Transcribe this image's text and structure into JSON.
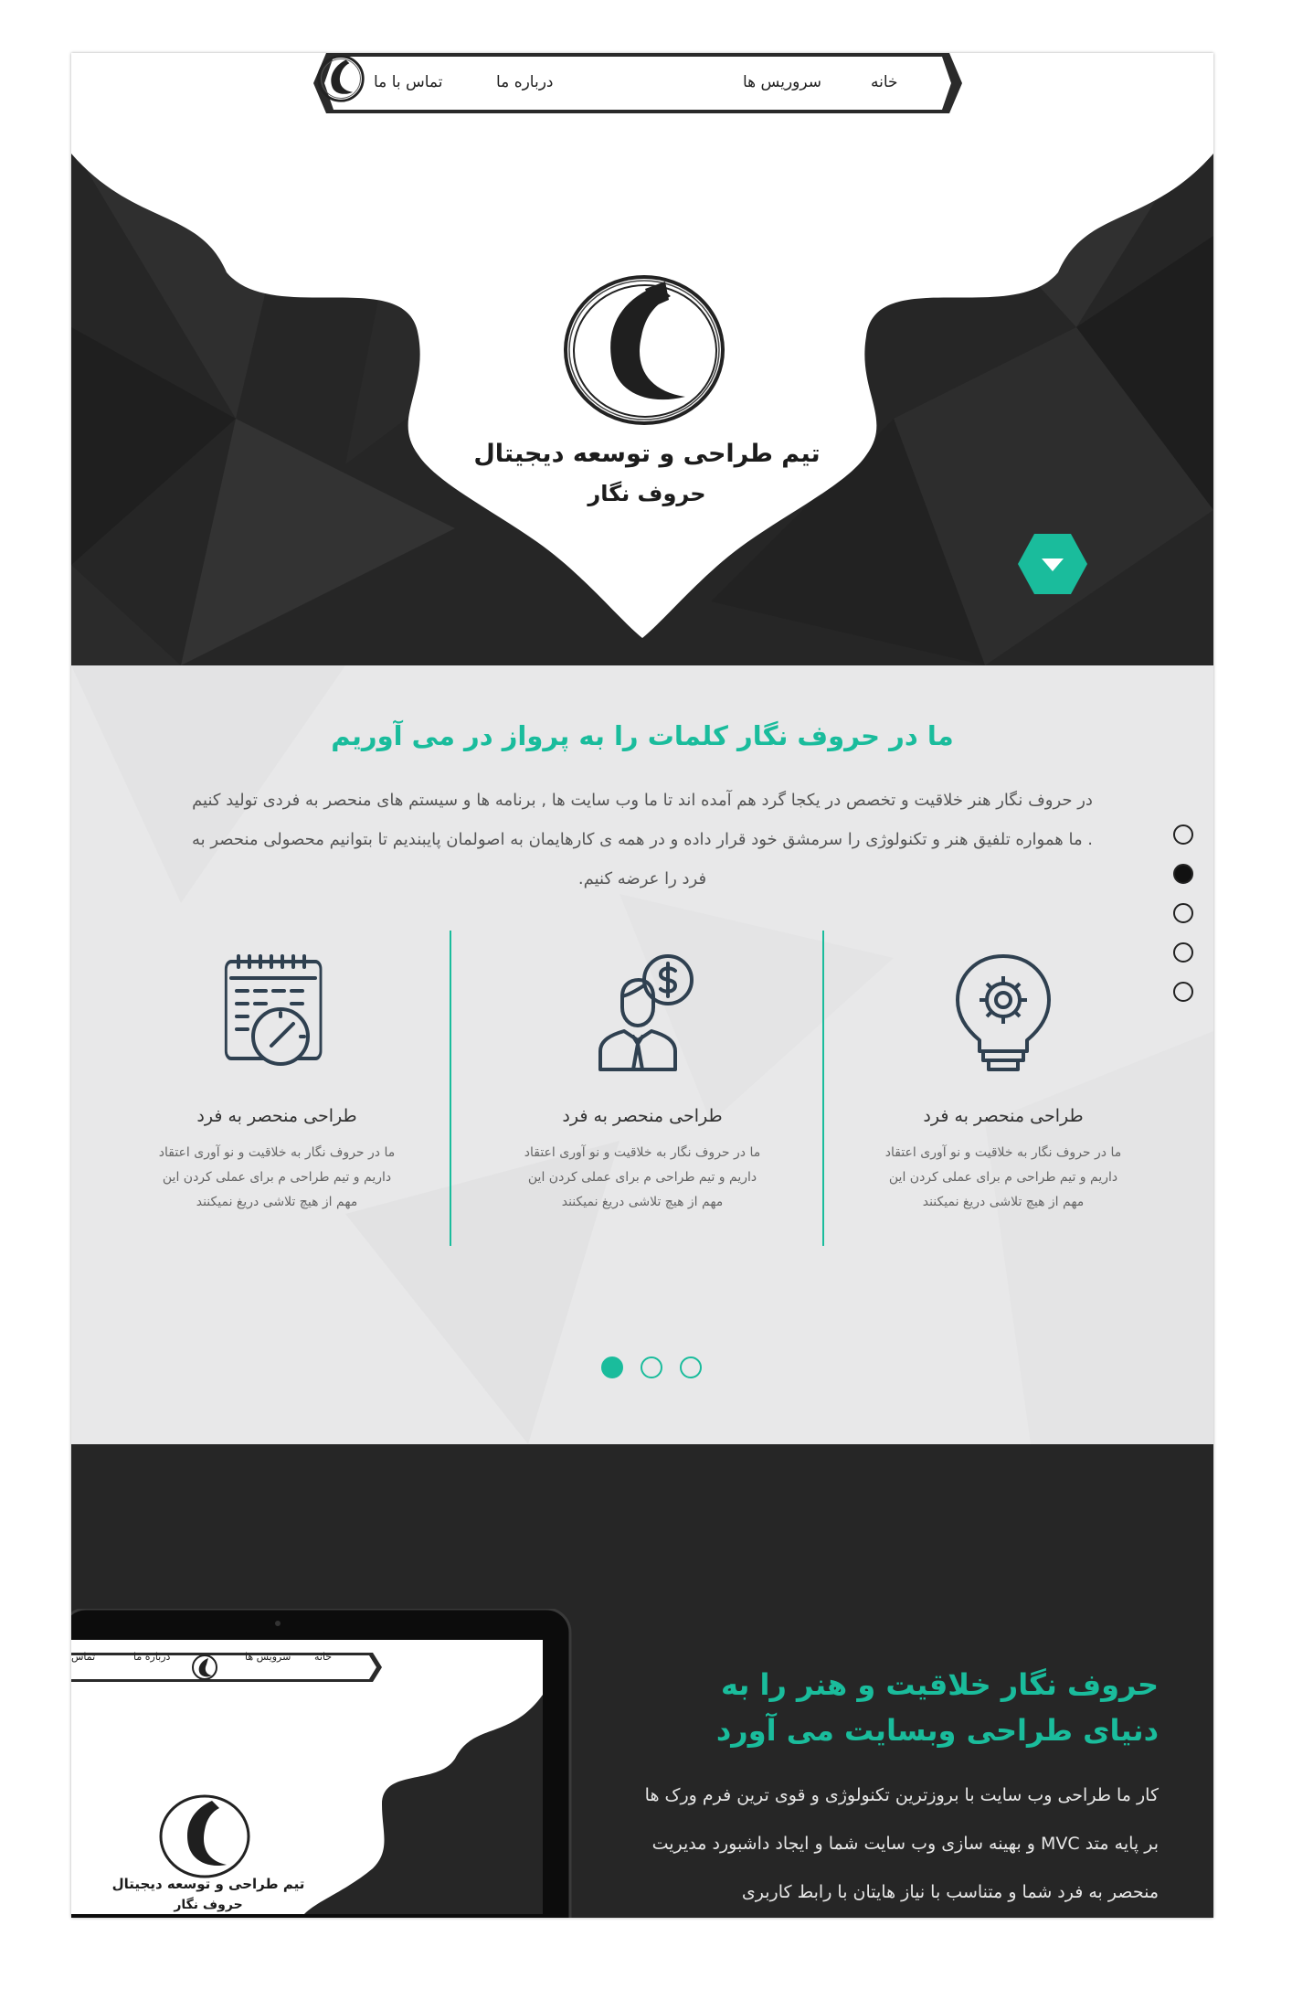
{
  "nav": {
    "home": "خانه",
    "services": "سروریس ها",
    "about": "درباره ما",
    "contact": "تماس با ما"
  },
  "hero": {
    "title": "تیم طراحی و توسعه دیجیتال",
    "subtitle": "حروف نگار"
  },
  "about": {
    "title": "ما در حروف نگار کلمات را به پرواز در می آوریم",
    "text": "در حروف نگار هنر خلاقیت و تخصص در یکجا گرد هم آمده اند تا ما وب سایت ها , برنامه ها و سیستم های منحصر به فردی تولید کنیم . ما همواره تلفیق هنر و تکنولوژی را سرمشق خود قرار داده و در همه ی کارهایمان به اصولمان پایبندیم تا بتوانیم محصولی منحصر به فرد را عرضه کنیم."
  },
  "features": [
    {
      "icon": "lightbulb-gear-icon",
      "title": "طراحی منحصر به فرد",
      "desc": "ما در حروف نگار به خلاقیت و نو آوری اعتقاد داریم و تیم طراحی م برای عملی کردن این مهم از هیچ تلاشی دریغ نمیکنند"
    },
    {
      "icon": "businessman-dollar-icon",
      "title": "طراحی منحصر به فرد",
      "desc": "ما در حروف نگار به خلاقیت و نو آوری اعتقاد داریم و تیم طراحی م برای عملی کردن این مهم از هیچ تلاشی دریغ نمیکنند"
    },
    {
      "icon": "calendar-clock-icon",
      "title": "طراحی منحصر به فرد",
      "desc": "ما در حروف نگار به خلاقیت و نو آوری اعتقاد داریم و تیم طراحی م برای عملی کردن این مهم از هیچ تلاشی دریغ نمیکنند"
    }
  ],
  "side_pager": {
    "count": 5,
    "active_index": 1
  },
  "slider_pager": {
    "count": 3,
    "active_index": 0
  },
  "showcase": {
    "title": "حروف نگار خلاقیت و هنر را به دنیای طراحی وبسایت می آورد",
    "text": "کار ما طراحی وب سایت با بروزترین تکنولوژی و قوی ترین فرم ورک ها بر پایه متد MVC و بهینه سازی وب سایت شما و ایجاد داشبورد مدیریت منحصر به فرد شما و متناسب با نیاز هایتان با رابط کاربری",
    "mini_nav": {
      "home": "خانه",
      "services": "سرویس ها",
      "about": "درباره ما",
      "contact": "تماس"
    },
    "mini_title": "تیم طراحی و توسعه دیجیتال",
    "mini_subtitle": "حروف نگار"
  },
  "colors": {
    "accent": "#1abc9c",
    "dark": "#262626",
    "light_bg": "#e8e8e9"
  }
}
